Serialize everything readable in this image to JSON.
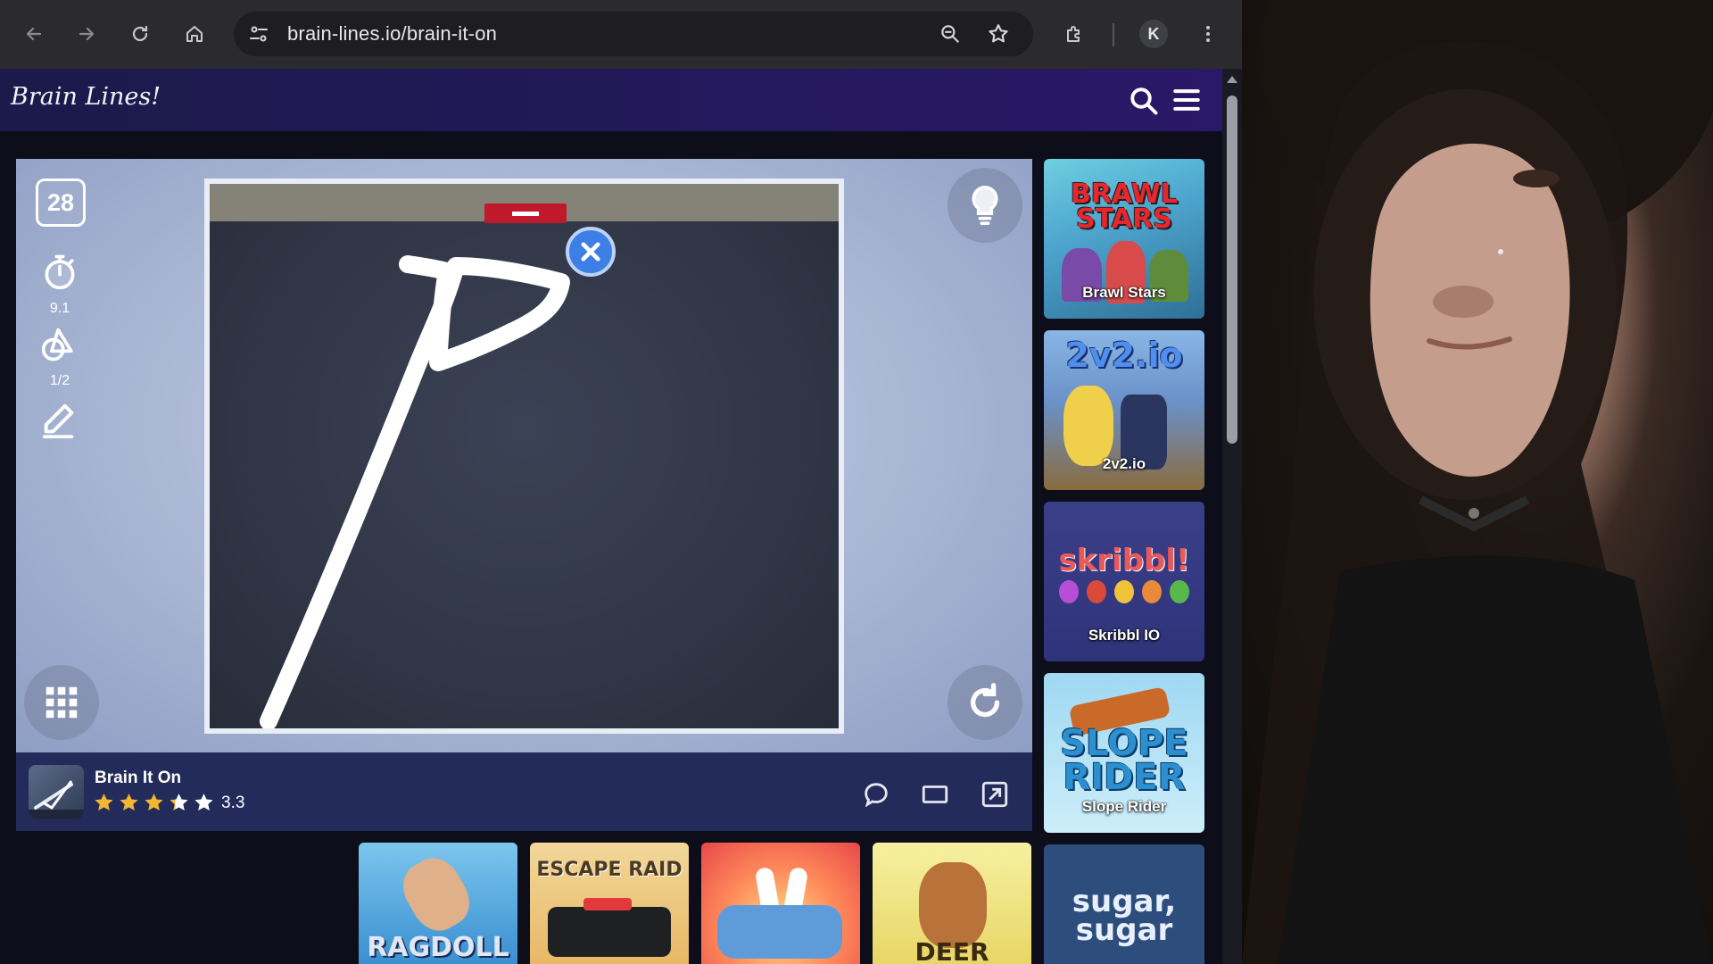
{
  "browser": {
    "url": "brain-lines.io/brain-it-on",
    "profile_initial": "K"
  },
  "site": {
    "logo": "Brain Lines!"
  },
  "game": {
    "level": "28",
    "timer_value": "9.1",
    "shapes_value": "1/2"
  },
  "info": {
    "title": "Brain It On",
    "rating": "3.3",
    "rating_stars": 3.3
  },
  "sidebar_games": [
    {
      "name": "Brawl Stars",
      "logo": "BRAWL STARS"
    },
    {
      "name": "2v2.io",
      "logo": "2v2.io"
    },
    {
      "name": "Skribbl IO",
      "logo": "skribbl!"
    },
    {
      "name": "Slope Rider",
      "logo": "SLOPE RIDER"
    },
    {
      "name": "",
      "logo": "sugar, sugar"
    }
  ],
  "bottom_games": [
    {
      "logo": "RAGDOLL"
    },
    {
      "logo": "ESCAPE RAID"
    },
    {
      "logo": ""
    },
    {
      "logo": "DEER"
    }
  ],
  "colors": {
    "header_start": "#1b1a4a",
    "header_end": "#2a1868",
    "infobar": "#222b5a",
    "target_red": "#c0192b",
    "close_blue": "#3e7fe6",
    "star_gold": "#f2b632"
  }
}
